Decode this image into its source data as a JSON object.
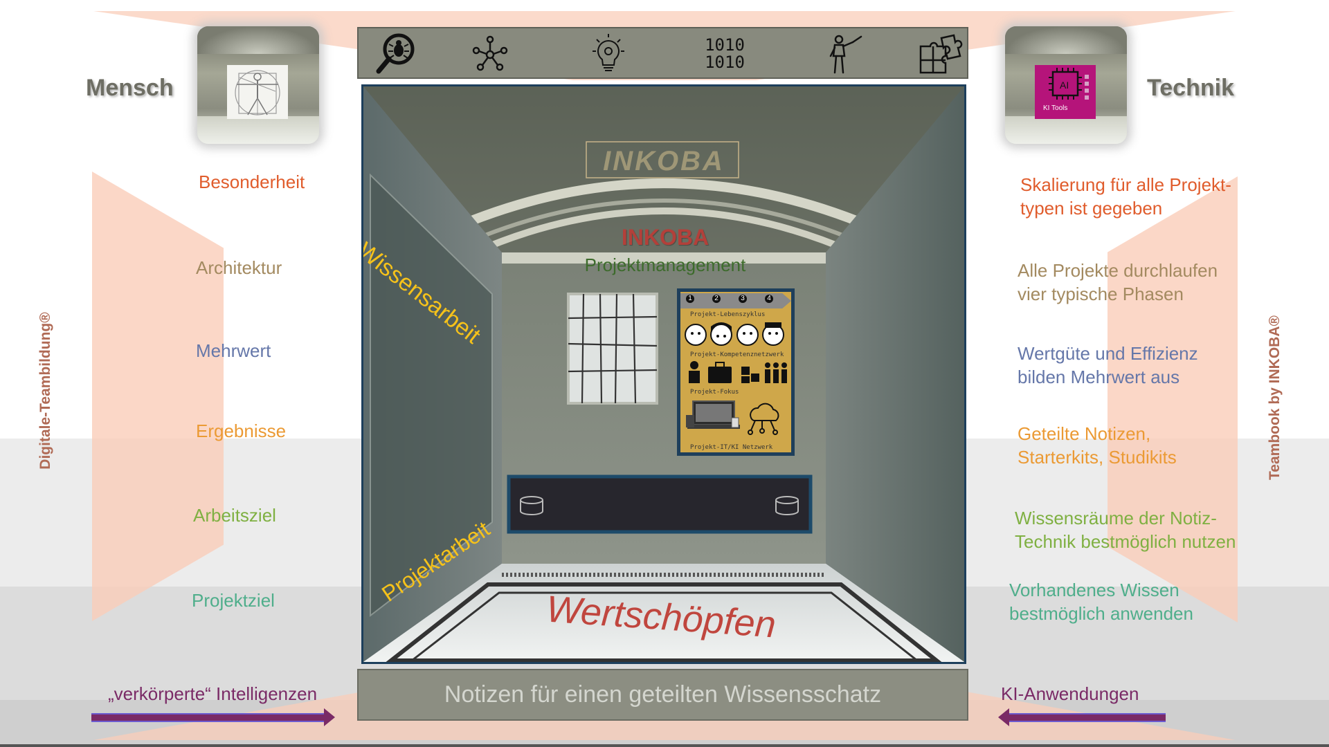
{
  "headers": {
    "left": "Mensch",
    "right": "Technik"
  },
  "thumbnails": {
    "right_caption": "KI Tools",
    "right_chip_label": "AI"
  },
  "left_labels": [
    {
      "text": "Besonderheit",
      "color": "#e05c2c"
    },
    {
      "text": "Architektur",
      "color": "#a38a60"
    },
    {
      "text": "Mehrwert",
      "color": "#6577a9"
    },
    {
      "text": "Ergebnisse",
      "color": "#eb9a34"
    },
    {
      "text": "Arbeitsziel",
      "color": "#7fb042"
    },
    {
      "text": "Projektziel",
      "color": "#4fae8b"
    }
  ],
  "right_texts": [
    {
      "line1": "Skalierung für alle Projekt-",
      "line2": "typen ist gegeben",
      "color": "#e05c2c"
    },
    {
      "line1": "Alle Projekte durchlaufen",
      "line2": "vier typische Phasen",
      "color": "#a38a60"
    },
    {
      "line1": "Wertgüte und Effizienz",
      "line2": "bilden Mehrwert aus",
      "color": "#6577a9"
    },
    {
      "line1": "Geteilte Notizen,",
      "line2": "Starterkits, Studikits",
      "color": "#eb9a34"
    },
    {
      "line1": "Wissensräume der Notiz-",
      "line2": "Technik bestmöglich nutzen",
      "color": "#7fb042"
    },
    {
      "line1": "Vorhandenes Wissen",
      "line2": "bestmöglich anwenden",
      "color": "#4fae8b"
    }
  ],
  "vertical": {
    "left": "Digitale-Teambildung®",
    "right": "Teambook by INKOBA®"
  },
  "toolbar_icons": [
    "bug-search-icon",
    "network-icon",
    "idea-gear-icon",
    "binary-icon",
    "presenter-icon",
    "puzzle-icon"
  ],
  "toolbar_binary": [
    "1010",
    "1010"
  ],
  "scene": {
    "plaque": "INKOBA",
    "title": "INKOBA",
    "subtitle": "Projektmanagement",
    "wall_text_top": "Wissensarbeit",
    "wall_text_bottom": "Projektarbeit",
    "floor_text": "Wertschöpfen"
  },
  "poster": {
    "steps": [
      "1",
      "2",
      "3",
      "4"
    ],
    "labels": [
      "Projekt-Lebenszyklus",
      "Projekt-Kompetenznetzwerk",
      "Projekt-Fokus",
      "Projekt-IT/KI Netzwerk"
    ]
  },
  "bottom": {
    "bar_text": "Notizen für einen geteilten Wissensschatz",
    "left_caption": "„verkörperte“ Intelligenzen",
    "right_caption": "KI-Anwendungen"
  },
  "colors": {
    "title_red": "#b3403a",
    "subtitle_green": "#3d6b2c",
    "wall_yellow": "#f6c21a",
    "floor_red": "#c0463e",
    "arrow": "#7a2a66"
  }
}
